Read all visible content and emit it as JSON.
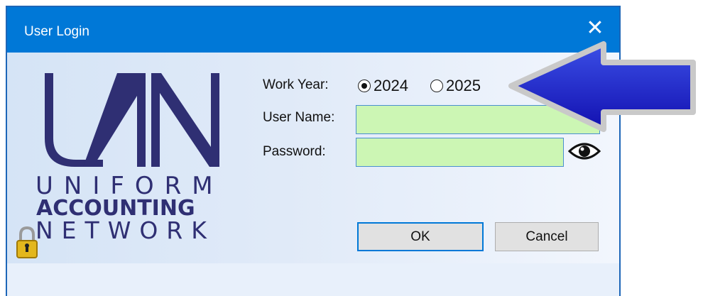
{
  "window": {
    "title": "User Login",
    "close_label": "✕"
  },
  "logo": {
    "mark": "UAN",
    "line1": "UNIFORM",
    "line2": "ACCOUNTING",
    "line3": "NETWORK"
  },
  "form": {
    "work_year": {
      "label": "Work Year:",
      "options": [
        {
          "label": "2024",
          "selected": true
        },
        {
          "label": "2025",
          "selected": false
        }
      ]
    },
    "user_name": {
      "label": "User Name:",
      "value": ""
    },
    "password": {
      "label": "Password:",
      "value": ""
    }
  },
  "buttons": {
    "ok": "OK",
    "cancel": "Cancel"
  },
  "icons": {
    "close": "close-icon",
    "show_password": "eye-icon",
    "lock": "lock-icon",
    "callout": "arrow-left-icon"
  },
  "colors": {
    "titlebar": "#0078d7",
    "field_bg": "#ccf6b4",
    "logo": "#2f2f73",
    "arrow": "#1f22c8"
  }
}
